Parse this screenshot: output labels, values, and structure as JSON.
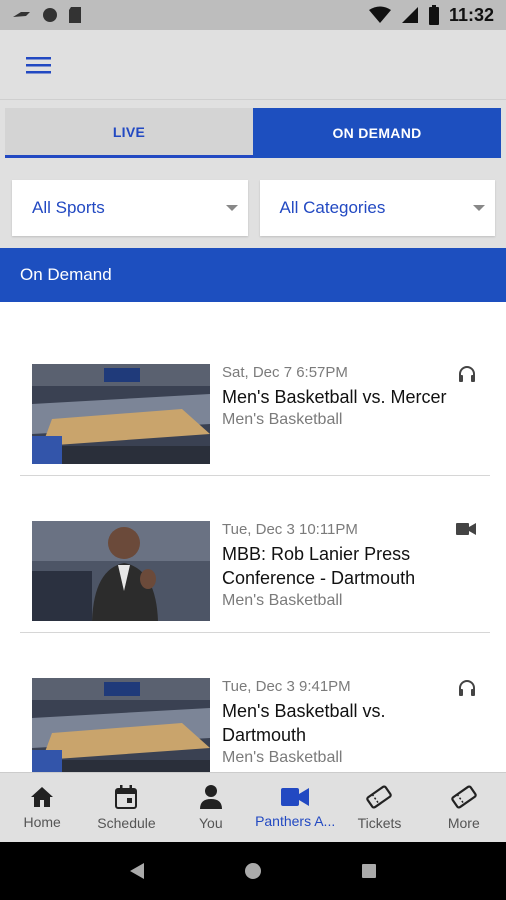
{
  "status_bar": {
    "time": "11:32"
  },
  "app_bar": {
    "menu_icon": "hamburger-menu-icon"
  },
  "tabs": [
    {
      "label": "LIVE",
      "selected": false
    },
    {
      "label": "ON DEMAND",
      "selected": true
    }
  ],
  "filters": {
    "sport": {
      "value": "All Sports"
    },
    "category": {
      "value": "All Categories"
    }
  },
  "section": {
    "title": "On Demand"
  },
  "items": [
    {
      "date": "Sat, Dec 7 6:57PM",
      "title": "Men's Basketball vs. Mercer",
      "sport": "Men's Basketball",
      "media_icon": "headphones-icon",
      "thumb": "arena-photo"
    },
    {
      "date": "Tue, Dec 3 10:11PM",
      "title": "MBB: Rob Lanier Press Conference - Dartmouth",
      "sport": "Men's Basketball",
      "media_icon": "video-camera-icon",
      "thumb": "coach-photo"
    },
    {
      "date": "Tue, Dec 3 9:41PM",
      "title": "Men's Basketball vs. Dartmouth",
      "sport": "Men's Basketball",
      "media_icon": "headphones-icon",
      "thumb": "arena-photo"
    }
  ],
  "bottom_nav": [
    {
      "label": "Home",
      "icon": "home-icon"
    },
    {
      "label": "Schedule",
      "icon": "calendar-icon"
    },
    {
      "label": "You",
      "icon": "person-icon"
    },
    {
      "label": "Panthers A...",
      "icon": "video-camera-icon",
      "active": true
    },
    {
      "label": "Tickets",
      "icon": "ticket-icon"
    },
    {
      "label": "More",
      "icon": "ticket-icon"
    }
  ],
  "colors": {
    "brand_blue": "#1d4fbf",
    "accent_text": "#2249c2",
    "muted_text": "#7b7b7b"
  }
}
